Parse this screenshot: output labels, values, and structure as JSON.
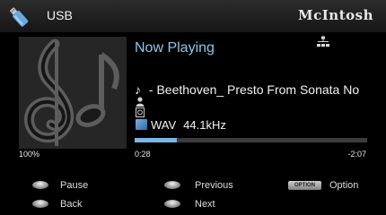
{
  "header": {
    "source": "USB",
    "brand": "McIntosh"
  },
  "now_playing": {
    "heading": "Now Playing",
    "title": " - Beethoven_ Presto From Sonata No",
    "artist": "",
    "album": "",
    "format": "WAV",
    "sample_rate": "44.1kHz"
  },
  "playback": {
    "volume": "100%",
    "elapsed": "0:28",
    "remaining": "-2:07",
    "progress_fraction": 0.18
  },
  "controls": {
    "pause_label": "Pause",
    "back_label": "Back",
    "previous_label": "Previous",
    "next_label": "Next",
    "option_key": "OPTION",
    "option_label": "Option"
  },
  "colors": {
    "accent": "#8fc6ec",
    "progress": "#7ab6e6",
    "background": "#000000"
  }
}
